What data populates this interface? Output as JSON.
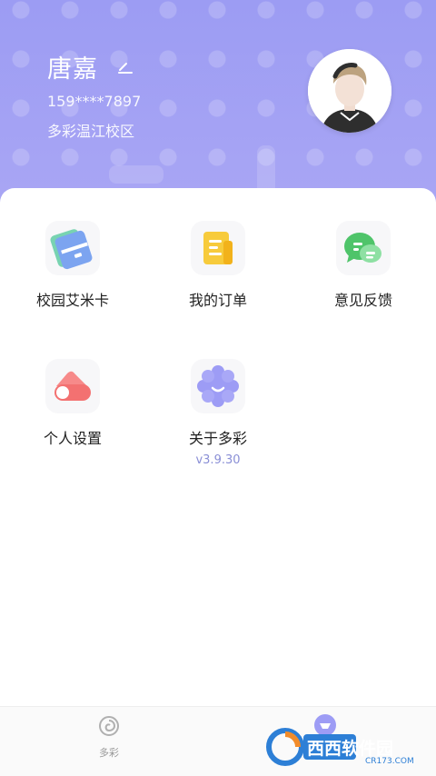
{
  "profile": {
    "name": "唐嘉",
    "phone": "159****7897",
    "campus": "多彩温江校区"
  },
  "menu": [
    {
      "label": "校园艾米卡",
      "icon": "campus-card-icon"
    },
    {
      "label": "我的订单",
      "icon": "order-document-icon"
    },
    {
      "label": "意见反馈",
      "icon": "feedback-chat-icon"
    },
    {
      "label": "个人设置",
      "icon": "settings-toggle-icon"
    },
    {
      "label": "关于多彩",
      "icon": "about-flower-icon",
      "version": "v3.9.30"
    }
  ],
  "tabbar": {
    "home_label": "多彩",
    "profile_label": ""
  },
  "watermark": {
    "text": "西西软件园",
    "url_text": "CR173.COM"
  },
  "colors": {
    "header": "#9c9cf3",
    "accent": "#8a8fd6"
  }
}
